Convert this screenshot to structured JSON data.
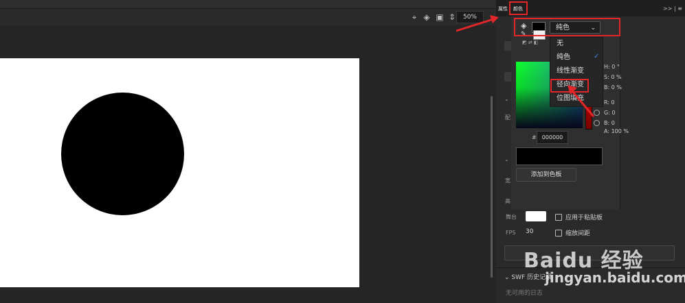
{
  "toolbar": {
    "zoom": "50%"
  },
  "panel": {
    "tabs": [
      "属性",
      "颜色"
    ],
    "tabs_right": ">> | ≡",
    "fill_type": "纯色",
    "fill_options": [
      "无",
      "纯色",
      "线性渐变",
      "径向渐变",
      "位图填充"
    ],
    "selected_option": "纯色",
    "highlighted_option": "径向渐变",
    "hsb": {
      "h": "H: 0 °",
      "s": "S: 0 %",
      "b": "B: 0 %"
    },
    "rgb": {
      "r": "R: 0",
      "g": "G: 0",
      "b": "B: 0"
    },
    "alpha": "A: 100 %",
    "hex_prefix": "#",
    "hex": "000000",
    "add_swatch": "添加到色板",
    "stage_label": "舞台",
    "fps_label": "FPS",
    "fps_value": "30",
    "apply_pasteboard": "应用于粘贴板",
    "scale_spacing": "缩放间距",
    "swf_label": "SWF",
    "history_label": "历史记录",
    "log_empty": "无可用的日志",
    "side_labels": [
      "宽",
      "高",
      "配"
    ],
    "colors": {
      "accent_red": "#e3262a",
      "fill_color": "#000000",
      "check_blue": "#3b8ee8"
    }
  },
  "watermark": {
    "logo": "Baidu 经验",
    "site": "jingyan.baidu.com"
  }
}
